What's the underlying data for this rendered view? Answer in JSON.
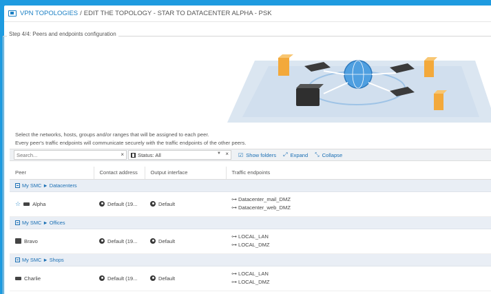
{
  "breadcrumb": {
    "root": "VPN TOPOLOGIES",
    "separator": "/",
    "current": "EDIT THE TOPOLOGY - STAR TO DATACENTER ALPHA - PSK"
  },
  "step": {
    "legend": "Step 4/4: Peers and endpoints configuration"
  },
  "description": {
    "line1": "Select the networks, hosts, groups and/or ranges that will be assigned to each peer.",
    "line2": "Every peer's traffic endpoints will communicate securely with the traffic endpoints of the other peers."
  },
  "toolbar": {
    "search_placeholder": "Search...",
    "clear_symbol": "×",
    "status_label": "Status: All",
    "show_folders": "Show folders",
    "expand": "Expand",
    "collapse": "Collapse"
  },
  "table": {
    "columns": [
      "Peer",
      "Contact address",
      "Output interface",
      "Traffic endpoints"
    ],
    "groups": [
      {
        "label": "My SMC ► Datacenters",
        "peer": "Alpha",
        "contact": "Default (19...",
        "output": "Default",
        "endpoints": [
          "Datacenter_mail_DMZ",
          "Datacenter_web_DMZ"
        ]
      },
      {
        "label": "My SMC ► Offices",
        "peer": "Bravo",
        "contact": "Default (19...",
        "output": "Default",
        "endpoints": [
          "LOCAL_LAN",
          "LOCAL_DMZ"
        ]
      },
      {
        "label": "My SMC ► Shops",
        "peer": "Charlie",
        "contact": "Default (19...",
        "output": "Default",
        "endpoints": [
          "LOCAL_LAN",
          "LOCAL_DMZ"
        ]
      }
    ]
  },
  "colors": {
    "background": "#1e9be0",
    "accent": "#1a7fc4",
    "group_row": "#e9eef5"
  }
}
